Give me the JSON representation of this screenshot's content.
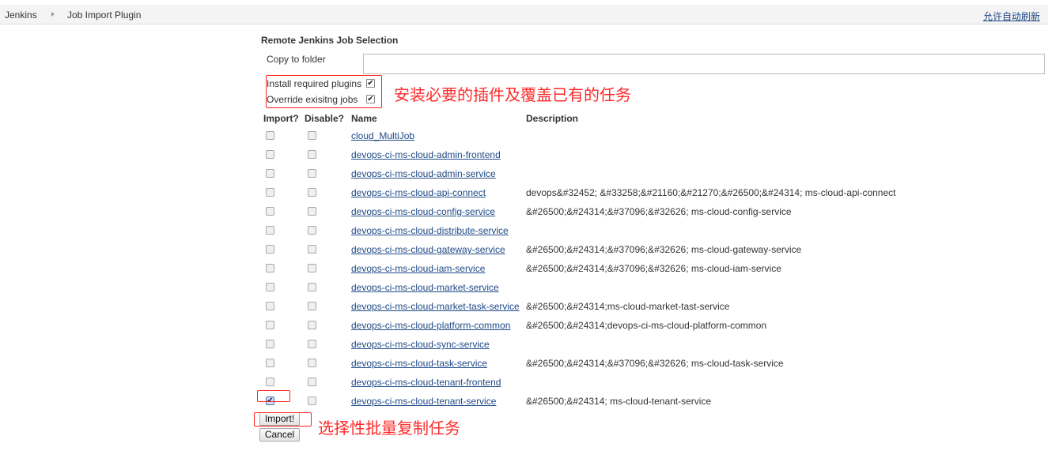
{
  "breadcrumb": {
    "root": "Jenkins",
    "current": "Job Import Plugin"
  },
  "auto_refresh_label": "允许自动刷新",
  "form": {
    "section_title": "Remote Jenkins Job Selection",
    "copy_to_folder_label": "Copy to folder",
    "copy_to_folder_value": "",
    "install_plugins_label": "Install required plugins",
    "install_plugins_checked": true,
    "override_jobs_label": "Override exisitng jobs",
    "override_jobs_checked": true
  },
  "annotations": {
    "options_note": "安装必要的插件及覆盖已有的任务",
    "import_note": "选择性批量复制任务"
  },
  "columns": {
    "import": "Import?",
    "disable": "Disable?",
    "name": "Name",
    "description": "Description"
  },
  "jobs": [
    {
      "name": "cloud_MultiJob",
      "description": "",
      "import": false,
      "disable": false
    },
    {
      "name": "devops-ci-ms-cloud-admin-frontend",
      "description": "",
      "import": false,
      "disable": false
    },
    {
      "name": "devops-ci-ms-cloud-admin-service",
      "description": "",
      "import": false,
      "disable": false
    },
    {
      "name": "devops-ci-ms-cloud-api-connect",
      "description": "devops&#32452; &#33258;&#21160;&#21270;&#26500;&#24314; ms-cloud-api-connect",
      "import": false,
      "disable": false
    },
    {
      "name": "devops-ci-ms-cloud-config-service",
      "description": "&#26500;&#24314;&#37096;&#32626; ms-cloud-config-service",
      "import": false,
      "disable": false
    },
    {
      "name": "devops-ci-ms-cloud-distribute-service",
      "description": "",
      "import": false,
      "disable": false
    },
    {
      "name": "devops-ci-ms-cloud-gateway-service",
      "description": "&#26500;&#24314;&#37096;&#32626; ms-cloud-gateway-service",
      "import": false,
      "disable": false
    },
    {
      "name": "devops-ci-ms-cloud-iam-service",
      "description": "&#26500;&#24314;&#37096;&#32626; ms-cloud-iam-service",
      "import": false,
      "disable": false
    },
    {
      "name": "devops-ci-ms-cloud-market-service",
      "description": "",
      "import": false,
      "disable": false
    },
    {
      "name": "devops-ci-ms-cloud-market-task-service",
      "description": "&#26500;&#24314;ms-cloud-market-tast-service",
      "import": false,
      "disable": false
    },
    {
      "name": "devops-ci-ms-cloud-platform-common",
      "description": "&#26500;&#24314;devops-ci-ms-cloud-platform-common",
      "import": false,
      "disable": false
    },
    {
      "name": "devops-ci-ms-cloud-sync-service",
      "description": "",
      "import": false,
      "disable": false
    },
    {
      "name": "devops-ci-ms-cloud-task-service",
      "description": "&#26500;&#24314;&#37096;&#32626; ms-cloud-task-service",
      "import": false,
      "disable": false
    },
    {
      "name": "devops-ci-ms-cloud-tenant-frontend",
      "description": "",
      "import": false,
      "disable": false
    },
    {
      "name": "devops-ci-ms-cloud-tenant-service",
      "description": "&#26500;&#24314; ms-cloud-tenant-service",
      "import": true,
      "disable": false
    }
  ],
  "buttons": {
    "import": "Import!",
    "cancel": "Cancel"
  },
  "colors": {
    "link": "#204a87",
    "annotation": "#ff2a2a"
  }
}
